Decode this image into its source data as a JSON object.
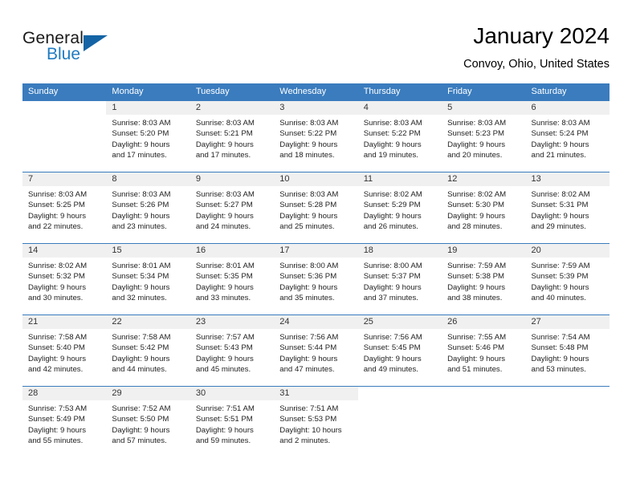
{
  "logo": {
    "word1": "General",
    "word2": "Blue",
    "icon": "triangle-icon",
    "accent_color": "#1464a5",
    "blue_text_color": "#1f7bc1"
  },
  "header": {
    "title": "January 2024",
    "subtitle": "Convoy, Ohio, United States"
  },
  "calendar": {
    "header_bg": "#3a7cbe",
    "day_band_bg": "#f0f0f0",
    "weekdays": [
      "Sunday",
      "Monday",
      "Tuesday",
      "Wednesday",
      "Thursday",
      "Friday",
      "Saturday"
    ],
    "weeks": [
      [
        {
          "num": "",
          "sunrise": "",
          "sunset": "",
          "daylight1": "",
          "daylight2": ""
        },
        {
          "num": "1",
          "sunrise": "Sunrise: 8:03 AM",
          "sunset": "Sunset: 5:20 PM",
          "daylight1": "Daylight: 9 hours",
          "daylight2": "and 17 minutes."
        },
        {
          "num": "2",
          "sunrise": "Sunrise: 8:03 AM",
          "sunset": "Sunset: 5:21 PM",
          "daylight1": "Daylight: 9 hours",
          "daylight2": "and 17 minutes."
        },
        {
          "num": "3",
          "sunrise": "Sunrise: 8:03 AM",
          "sunset": "Sunset: 5:22 PM",
          "daylight1": "Daylight: 9 hours",
          "daylight2": "and 18 minutes."
        },
        {
          "num": "4",
          "sunrise": "Sunrise: 8:03 AM",
          "sunset": "Sunset: 5:22 PM",
          "daylight1": "Daylight: 9 hours",
          "daylight2": "and 19 minutes."
        },
        {
          "num": "5",
          "sunrise": "Sunrise: 8:03 AM",
          "sunset": "Sunset: 5:23 PM",
          "daylight1": "Daylight: 9 hours",
          "daylight2": "and 20 minutes."
        },
        {
          "num": "6",
          "sunrise": "Sunrise: 8:03 AM",
          "sunset": "Sunset: 5:24 PM",
          "daylight1": "Daylight: 9 hours",
          "daylight2": "and 21 minutes."
        }
      ],
      [
        {
          "num": "7",
          "sunrise": "Sunrise: 8:03 AM",
          "sunset": "Sunset: 5:25 PM",
          "daylight1": "Daylight: 9 hours",
          "daylight2": "and 22 minutes."
        },
        {
          "num": "8",
          "sunrise": "Sunrise: 8:03 AM",
          "sunset": "Sunset: 5:26 PM",
          "daylight1": "Daylight: 9 hours",
          "daylight2": "and 23 minutes."
        },
        {
          "num": "9",
          "sunrise": "Sunrise: 8:03 AM",
          "sunset": "Sunset: 5:27 PM",
          "daylight1": "Daylight: 9 hours",
          "daylight2": "and 24 minutes."
        },
        {
          "num": "10",
          "sunrise": "Sunrise: 8:03 AM",
          "sunset": "Sunset: 5:28 PM",
          "daylight1": "Daylight: 9 hours",
          "daylight2": "and 25 minutes."
        },
        {
          "num": "11",
          "sunrise": "Sunrise: 8:02 AM",
          "sunset": "Sunset: 5:29 PM",
          "daylight1": "Daylight: 9 hours",
          "daylight2": "and 26 minutes."
        },
        {
          "num": "12",
          "sunrise": "Sunrise: 8:02 AM",
          "sunset": "Sunset: 5:30 PM",
          "daylight1": "Daylight: 9 hours",
          "daylight2": "and 28 minutes."
        },
        {
          "num": "13",
          "sunrise": "Sunrise: 8:02 AM",
          "sunset": "Sunset: 5:31 PM",
          "daylight1": "Daylight: 9 hours",
          "daylight2": "and 29 minutes."
        }
      ],
      [
        {
          "num": "14",
          "sunrise": "Sunrise: 8:02 AM",
          "sunset": "Sunset: 5:32 PM",
          "daylight1": "Daylight: 9 hours",
          "daylight2": "and 30 minutes."
        },
        {
          "num": "15",
          "sunrise": "Sunrise: 8:01 AM",
          "sunset": "Sunset: 5:34 PM",
          "daylight1": "Daylight: 9 hours",
          "daylight2": "and 32 minutes."
        },
        {
          "num": "16",
          "sunrise": "Sunrise: 8:01 AM",
          "sunset": "Sunset: 5:35 PM",
          "daylight1": "Daylight: 9 hours",
          "daylight2": "and 33 minutes."
        },
        {
          "num": "17",
          "sunrise": "Sunrise: 8:00 AM",
          "sunset": "Sunset: 5:36 PM",
          "daylight1": "Daylight: 9 hours",
          "daylight2": "and 35 minutes."
        },
        {
          "num": "18",
          "sunrise": "Sunrise: 8:00 AM",
          "sunset": "Sunset: 5:37 PM",
          "daylight1": "Daylight: 9 hours",
          "daylight2": "and 37 minutes."
        },
        {
          "num": "19",
          "sunrise": "Sunrise: 7:59 AM",
          "sunset": "Sunset: 5:38 PM",
          "daylight1": "Daylight: 9 hours",
          "daylight2": "and 38 minutes."
        },
        {
          "num": "20",
          "sunrise": "Sunrise: 7:59 AM",
          "sunset": "Sunset: 5:39 PM",
          "daylight1": "Daylight: 9 hours",
          "daylight2": "and 40 minutes."
        }
      ],
      [
        {
          "num": "21",
          "sunrise": "Sunrise: 7:58 AM",
          "sunset": "Sunset: 5:40 PM",
          "daylight1": "Daylight: 9 hours",
          "daylight2": "and 42 minutes."
        },
        {
          "num": "22",
          "sunrise": "Sunrise: 7:58 AM",
          "sunset": "Sunset: 5:42 PM",
          "daylight1": "Daylight: 9 hours",
          "daylight2": "and 44 minutes."
        },
        {
          "num": "23",
          "sunrise": "Sunrise: 7:57 AM",
          "sunset": "Sunset: 5:43 PM",
          "daylight1": "Daylight: 9 hours",
          "daylight2": "and 45 minutes."
        },
        {
          "num": "24",
          "sunrise": "Sunrise: 7:56 AM",
          "sunset": "Sunset: 5:44 PM",
          "daylight1": "Daylight: 9 hours",
          "daylight2": "and 47 minutes."
        },
        {
          "num": "25",
          "sunrise": "Sunrise: 7:56 AM",
          "sunset": "Sunset: 5:45 PM",
          "daylight1": "Daylight: 9 hours",
          "daylight2": "and 49 minutes."
        },
        {
          "num": "26",
          "sunrise": "Sunrise: 7:55 AM",
          "sunset": "Sunset: 5:46 PM",
          "daylight1": "Daylight: 9 hours",
          "daylight2": "and 51 minutes."
        },
        {
          "num": "27",
          "sunrise": "Sunrise: 7:54 AM",
          "sunset": "Sunset: 5:48 PM",
          "daylight1": "Daylight: 9 hours",
          "daylight2": "and 53 minutes."
        }
      ],
      [
        {
          "num": "28",
          "sunrise": "Sunrise: 7:53 AM",
          "sunset": "Sunset: 5:49 PM",
          "daylight1": "Daylight: 9 hours",
          "daylight2": "and 55 minutes."
        },
        {
          "num": "29",
          "sunrise": "Sunrise: 7:52 AM",
          "sunset": "Sunset: 5:50 PM",
          "daylight1": "Daylight: 9 hours",
          "daylight2": "and 57 minutes."
        },
        {
          "num": "30",
          "sunrise": "Sunrise: 7:51 AM",
          "sunset": "Sunset: 5:51 PM",
          "daylight1": "Daylight: 9 hours",
          "daylight2": "and 59 minutes."
        },
        {
          "num": "31",
          "sunrise": "Sunrise: 7:51 AM",
          "sunset": "Sunset: 5:53 PM",
          "daylight1": "Daylight: 10 hours",
          "daylight2": "and 2 minutes."
        },
        {
          "num": "",
          "sunrise": "",
          "sunset": "",
          "daylight1": "",
          "daylight2": ""
        },
        {
          "num": "",
          "sunrise": "",
          "sunset": "",
          "daylight1": "",
          "daylight2": ""
        },
        {
          "num": "",
          "sunrise": "",
          "sunset": "",
          "daylight1": "",
          "daylight2": ""
        }
      ]
    ]
  }
}
